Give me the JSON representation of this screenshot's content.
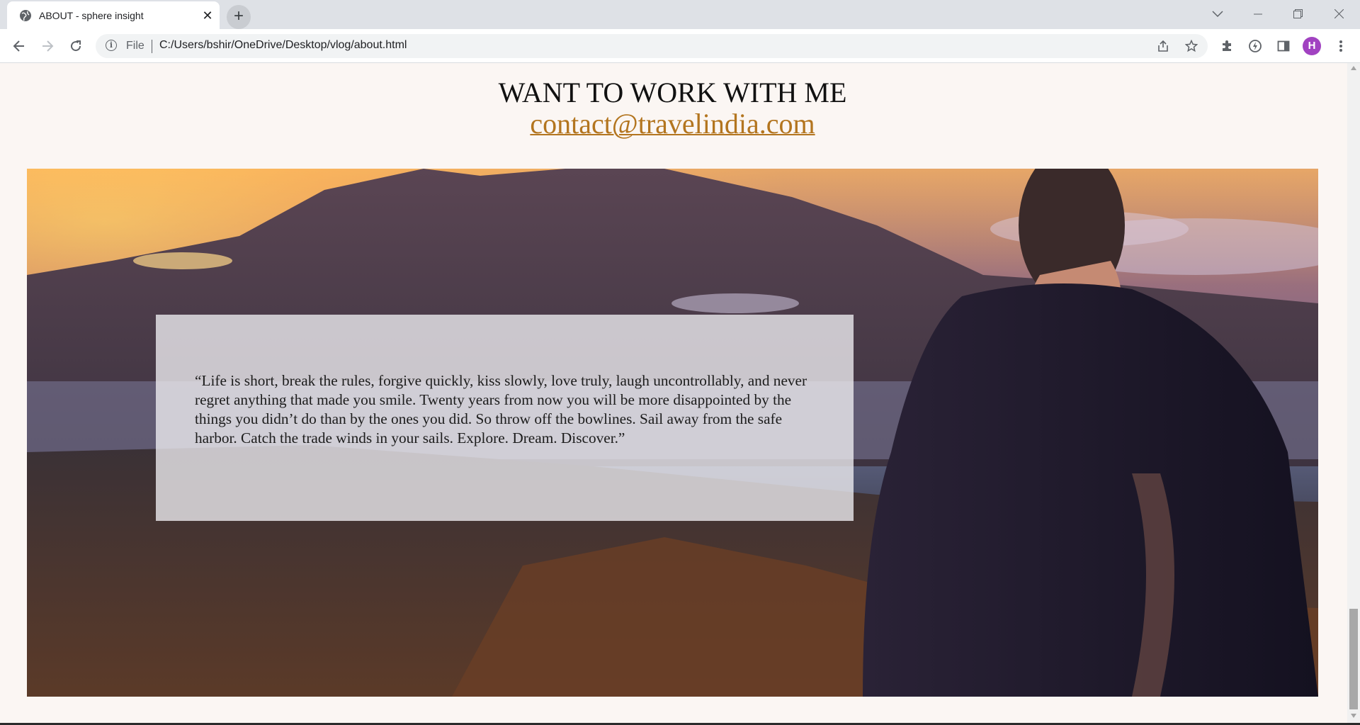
{
  "browser": {
    "tab_title": "ABOUT - sphere insight",
    "tab_close_glyph": "✕",
    "new_tab_glyph": "+",
    "scheme_label": "File",
    "url": "C:/Users/bshir/OneDrive/Desktop/vlog/about.html",
    "profile_initial": "H",
    "icons": [
      "globe-icon",
      "close-icon",
      "plus-icon",
      "chevron-down-icon",
      "minimize-icon",
      "restore-icon",
      "close-window-icon",
      "back-arrow-icon",
      "forward-arrow-icon",
      "reload-icon",
      "info-icon",
      "share-icon",
      "star-icon",
      "puzzle-extensions-icon",
      "performance-icon",
      "side-panel-icon",
      "kebab-menu-icon"
    ]
  },
  "page": {
    "heading": "WANT TO WORK WITH ME",
    "email": "contact@travelindia.com",
    "quote": "“Life is short, break the rules, forgive quickly, kiss slowly, love truly, laugh uncontrollably, and never regret anything that made you smile. Twenty years from now you will be more disappointed by the things you didn’t do than by the ones you did. So throw off the bowlines. Sail away from the safe harbor. Catch the trade winds in your sails. Explore. Dream. Discover.”"
  },
  "colors": {
    "page_bg": "#fbf6f3",
    "link": "#b3751f",
    "profile_avatar": "#a142c1"
  }
}
